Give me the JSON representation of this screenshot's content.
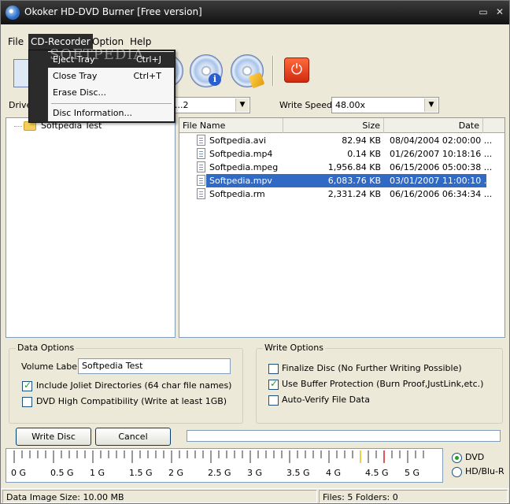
{
  "window": {
    "title": "Okoker HD-DVD Burner  [Free version]",
    "min_glyph": "▭",
    "close_glyph": "✕"
  },
  "menubar": {
    "file": "File",
    "cd_recorder": "CD-Recorder",
    "option": "Option",
    "help": "Help"
  },
  "dropdown": {
    "items": [
      {
        "label": "Eject Tray",
        "shortcut": "Ctrl+J"
      },
      {
        "label": "Close Tray",
        "shortcut": "Ctrl+T"
      },
      {
        "label": "Erase Disc..."
      },
      {
        "label": "Disc Information..."
      }
    ]
  },
  "watermark": "SOFTPEDIA",
  "toolbar": {
    "info_glyph": "i",
    "exit_glyph": "⏻"
  },
  "drive": {
    "label": "Drive:",
    "value": "...2"
  },
  "write_speed": {
    "label": "Write Speed:",
    "value": "48.00x"
  },
  "combo_arrow": "▼",
  "tree": {
    "root_label": "Softpedia Test"
  },
  "file_list": {
    "columns": {
      "name": "File Name",
      "size": "Size",
      "date": "Date"
    },
    "rows": [
      {
        "name": "Softpedia.avi",
        "size": "82.94 KB",
        "date": "08/04/2004 02:00:00 ..."
      },
      {
        "name": "Softpedia.mp4",
        "size": "0.14 KB",
        "date": "01/26/2007 10:18:16 ..."
      },
      {
        "name": "Softpedia.mpeg",
        "size": "1,956.84 KB",
        "date": "06/15/2006 05:00:38 ..."
      },
      {
        "name": "Softpedia.mpv",
        "size": "6,083.76 KB",
        "date": "03/01/2007 11:00:10 ...",
        "selected": true
      },
      {
        "name": "Softpedia.rm",
        "size": "2,331.24 KB",
        "date": "06/16/2006 06:34:34 ..."
      }
    ]
  },
  "data_options": {
    "title": "Data Options",
    "volume_label_caption": "Volume Label:",
    "volume_label_value": "Softpedia Test",
    "joliet": {
      "label": "Include Joliet Directories (64 char file names)",
      "checked": true
    },
    "dvd_compat": {
      "label": "DVD High Compatibility (Write at least 1GB)",
      "checked": false
    }
  },
  "write_options": {
    "title": "Write Options",
    "finalize": {
      "label": "Finalize Disc (No Further Writing Possible)",
      "checked": false
    },
    "buffer_proof": {
      "label": "Use Buffer Protection (Burn Proof,JustLink,etc.)",
      "checked": true
    },
    "auto_verify": {
      "label": "Auto-Verify File Data",
      "checked": false
    }
  },
  "buttons": {
    "write": "Write Disc",
    "cancel": "Cancel"
  },
  "ruler": {
    "labels": [
      "0 G",
      "0.5 G",
      "1 G",
      "1.5 G",
      "2 G",
      "2.5 G",
      "3 G",
      "3.5 G",
      "4 G",
      "4.5 G",
      "5 G"
    ],
    "marker_colors": {
      "yellow": "#e8c000",
      "red": "#d22020"
    }
  },
  "media": {
    "dvd": "DVD",
    "hd": "HD/Blu-R",
    "selected": "dvd"
  },
  "status": {
    "size": "Data Image Size: 10.00 MB",
    "counts": "Files: 5  Folders: 0"
  }
}
